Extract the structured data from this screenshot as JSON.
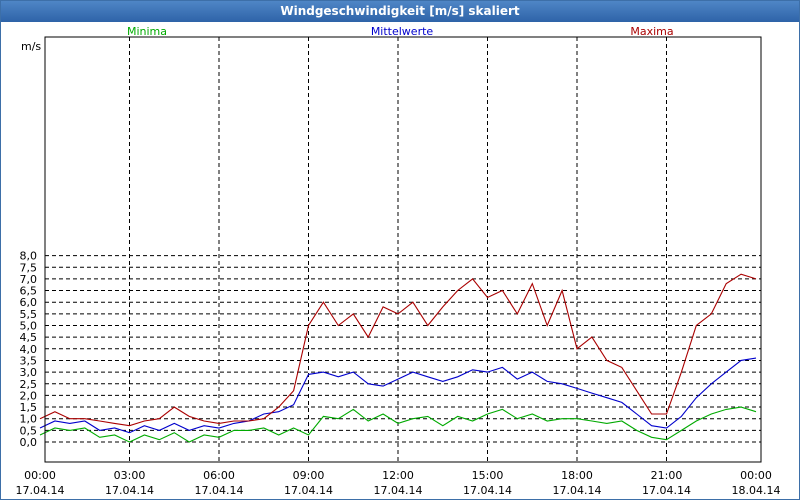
{
  "window": {
    "title": "Windgeschwindigkeit [m/s] skaliert"
  },
  "chart_data": {
    "type": "line",
    "title": "Windgeschwindigkeit [m/s] skaliert",
    "ylabel": "m/s",
    "xlabel": "",
    "ylim": [
      -0.3,
      8.5
    ],
    "xlim": [
      0,
      24
    ],
    "grid": true,
    "legend_placement": "top",
    "y_ticks": [
      "0,0",
      "0,5",
      "1,0",
      "1,5",
      "2,0",
      "2,5",
      "3,0",
      "3,5",
      "4,0",
      "4,5",
      "5,0",
      "5,5",
      "6,0",
      "6,5",
      "7,0",
      "7,5",
      "8,0"
    ],
    "x_ticks": [
      {
        "time": "00:00",
        "date": "17.04.14"
      },
      {
        "time": "03:00",
        "date": "17.04.14"
      },
      {
        "time": "06:00",
        "date": "17.04.14"
      },
      {
        "time": "09:00",
        "date": "17.04.14"
      },
      {
        "time": "12:00",
        "date": "17.04.14"
      },
      {
        "time": "15:00",
        "date": "17.04.14"
      },
      {
        "time": "18:00",
        "date": "17.04.14"
      },
      {
        "time": "21:00",
        "date": "17.04.14"
      },
      {
        "time": "00:00",
        "date": "18.04.14"
      }
    ],
    "x_hours": [
      0,
      0.5,
      1,
      1.5,
      2,
      2.5,
      3,
      3.5,
      4,
      4.5,
      5,
      5.5,
      6,
      6.5,
      7,
      7.5,
      8,
      8.5,
      9,
      9.5,
      10,
      10.5,
      11,
      11.5,
      12,
      12.5,
      13,
      13.5,
      14,
      14.5,
      15,
      15.5,
      16,
      16.5,
      17,
      17.5,
      18,
      18.5,
      19,
      19.5,
      20,
      20.5,
      21,
      21.5,
      22,
      22.5,
      23,
      23.5,
      24
    ],
    "series": [
      {
        "name": "Minima",
        "color": "#00aa00",
        "values": [
          0.3,
          0.6,
          0.5,
          0.6,
          0.2,
          0.3,
          0.0,
          0.3,
          0.1,
          0.4,
          0.0,
          0.3,
          0.2,
          0.5,
          0.5,
          0.6,
          0.3,
          0.6,
          0.3,
          1.1,
          1.0,
          1.4,
          0.9,
          1.2,
          0.8,
          1.0,
          1.1,
          0.7,
          1.1,
          0.9,
          1.2,
          1.4,
          1.0,
          1.2,
          0.9,
          1.0,
          1.0,
          0.9,
          0.8,
          0.9,
          0.5,
          0.2,
          0.1,
          0.5,
          0.9,
          1.2,
          1.4,
          1.5,
          1.3
        ]
      },
      {
        "name": "Mittelwerte",
        "color": "#0000cc",
        "values": [
          0.6,
          0.9,
          0.8,
          0.9,
          0.5,
          0.6,
          0.4,
          0.7,
          0.5,
          0.8,
          0.5,
          0.7,
          0.6,
          0.8,
          0.9,
          1.2,
          1.3,
          1.6,
          2.9,
          3.0,
          2.8,
          3.0,
          2.5,
          2.4,
          2.7,
          3.0,
          2.8,
          2.6,
          2.8,
          3.1,
          3.0,
          3.2,
          2.7,
          3.0,
          2.6,
          2.5,
          2.3,
          2.1,
          1.9,
          1.7,
          1.2,
          0.7,
          0.6,
          1.1,
          1.9,
          2.5,
          3.0,
          3.5,
          3.6
        ]
      },
      {
        "name": "Maxima",
        "color": "#aa0000",
        "values": [
          1.0,
          1.3,
          1.0,
          1.0,
          0.9,
          0.8,
          0.7,
          0.9,
          1.0,
          1.5,
          1.1,
          0.9,
          0.8,
          0.9,
          0.9,
          1.0,
          1.5,
          2.2,
          5.0,
          6.0,
          5.0,
          5.5,
          4.5,
          5.8,
          5.5,
          6.0,
          5.0,
          5.8,
          6.5,
          7.0,
          6.2,
          6.5,
          5.5,
          6.8,
          5.0,
          6.5,
          4.0,
          4.5,
          3.5,
          3.2,
          2.2,
          1.2,
          1.2,
          3.0,
          5.0,
          5.5,
          6.8,
          7.2,
          7.0
        ]
      }
    ]
  }
}
